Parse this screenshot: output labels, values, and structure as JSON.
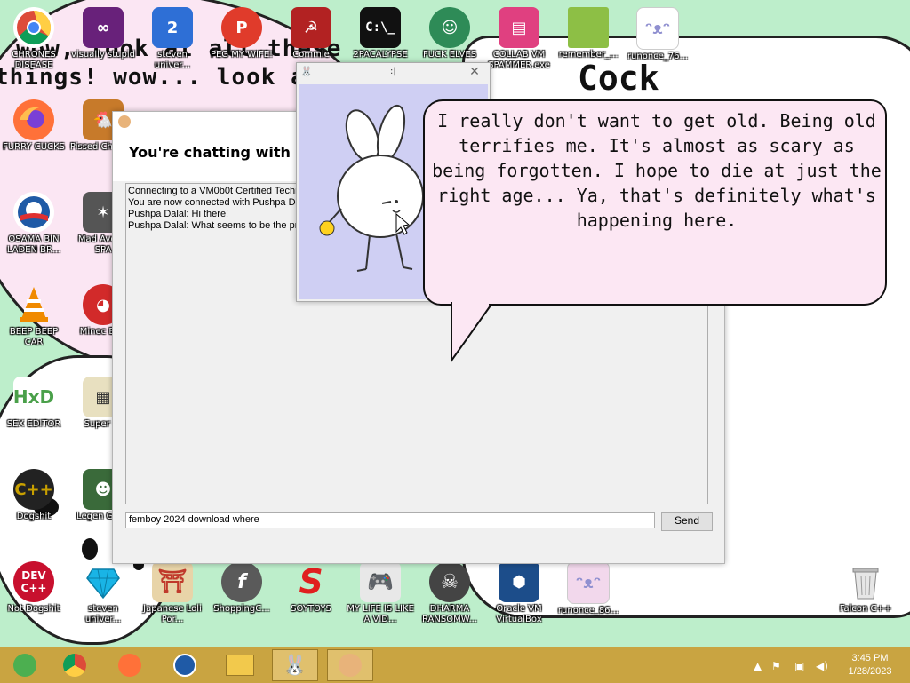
{
  "wallpaper": {
    "line1": "wow, look at all these",
    "line2": "things! wow... look at tha",
    "cock_text": "Cock"
  },
  "desktop_icons": [
    {
      "label": "CHRONES DISEASE",
      "icon": "chrome-icon",
      "color": "#dd4b39"
    },
    {
      "label": "visually stupid",
      "icon": "visual-studio-icon",
      "color": "#68217a"
    },
    {
      "label": "steven univer...",
      "icon": "steven-universe-icon",
      "color": "#2e6fd6"
    },
    {
      "label": "PEG MY WIFE!",
      "icon": "peggle-icon",
      "color": "#e03b2b"
    },
    {
      "label": "Commie",
      "icon": "commie-icon",
      "color": "#b22222"
    },
    {
      "label": "2PACALYPSE",
      "icon": "cmd-icon",
      "color": "#111111"
    },
    {
      "label": "FUCK ELVES",
      "icon": "elf-icon",
      "color": "#2e8b57"
    },
    {
      "label": "COLLAB VM SPAMMER.exe",
      "icon": "spammer-icon",
      "color": "#e04080"
    },
    {
      "label": "remember_...",
      "icon": "folder-icon",
      "color": "#8dbf45"
    },
    {
      "label": "runonce_76...",
      "icon": "bunny-file-icon",
      "color": "#e8e0f8"
    },
    {
      "label": "FURRY CUCKS",
      "icon": "firefox-icon",
      "color": "#ff7139"
    },
    {
      "label": "Pissed Chicken",
      "icon": "chicken-icon",
      "color": "#c77a2a"
    },
    {
      "label": "OSAMA BIN LADEN BR...",
      "icon": "obama-icon",
      "color": "#1f5aa6"
    },
    {
      "label": "Mad Ave IN SPA",
      "icon": "spider-icon",
      "color": "#555555"
    },
    {
      "label": "BEEP BEEP CAR",
      "icon": "vlc-icon",
      "color": "#f08a00"
    },
    {
      "label": "Minec Bird",
      "icon": "angry-bird-icon",
      "color": "#d22a2a"
    },
    {
      "label": "SEX EDITOR",
      "icon": "hxd-icon",
      "color": "#4aa04a"
    },
    {
      "label": "Super Gi",
      "icon": "pixel-icon",
      "color": "#777777"
    },
    {
      "label": "Dogshit",
      "icon": "dogshit-icon",
      "color": "#c8a000"
    },
    {
      "label": "Legen GRYA",
      "icon": "legend-icon",
      "color": "#3a6a3a"
    },
    {
      "label": "Not Dogshit",
      "icon": "dev-cpp-icon",
      "color": "#c8102e"
    },
    {
      "label": "steven univer...",
      "icon": "diamond-icon",
      "color": "#19b4e6"
    },
    {
      "label": "Japanese Loli Por...",
      "icon": "torii-icon",
      "color": "#e8d4a8"
    },
    {
      "label": "ShoppingC...",
      "icon": "flash-icon",
      "color": "#5a5a5a"
    },
    {
      "label": "SOYTOYS",
      "icon": "s-icon",
      "color": "#e01f1f"
    },
    {
      "label": "MY LIFE IS LIKE A VID...",
      "icon": "gamepad-icon",
      "color": "#d0d0d0"
    },
    {
      "label": "DHARMA RANSOMW...",
      "icon": "skull-icon",
      "color": "#444444"
    },
    {
      "label": "Oracle VM VirtualBox",
      "icon": "virtualbox-icon",
      "color": "#1c4d8a"
    },
    {
      "label": "runonce_86...",
      "icon": "bunny-file-icon",
      "color": "#f2d8ec"
    },
    {
      "label": "Falcon C++",
      "icon": "recycle-bin-icon",
      "color": "#cfcfcf"
    }
  ],
  "chat_window": {
    "heading": "You're chatting with a V",
    "log": [
      "Connecting to a VM0b0t Certified Techn",
      "You are now connected with Pushpa Da",
      "Pushpa Dalal: Hi there!",
      "Pushpa Dalal: What seems to be the pro"
    ],
    "input_value": "femboy 2024 download where",
    "send_label": "Send"
  },
  "bunny_window": {
    "title": ":|",
    "close_label": "✕"
  },
  "speech_bubble": {
    "text": "I really don't want to get old. Being old terrifies me. It's almost as scary as being forgotten. I hope to die at just the right age... Ya, that's definitely what's happening here."
  },
  "taskbar": {
    "buttons": [
      {
        "icon": "chrome-alt-icon",
        "color": "#4caf50"
      },
      {
        "icon": "chrome-icon",
        "color": "#dd4b39"
      },
      {
        "icon": "firefox-icon",
        "color": "#ff7139"
      },
      {
        "icon": "obama-icon",
        "color": "#1f5aa6"
      },
      {
        "icon": "file-explorer-icon",
        "color": "#f2c94c"
      },
      {
        "icon": "bunny-icon",
        "color": "#ffffff"
      },
      {
        "icon": "support-agent-icon",
        "color": "#e8b37a"
      }
    ],
    "time": "3:45 PM",
    "date": "1/28/2023"
  },
  "colors": {
    "wallpaper_green": "#bdeecb",
    "taskbar": "#c9a441",
    "bubble_fill": "#fce7f3",
    "bunny_bg": "#cfcff3"
  }
}
